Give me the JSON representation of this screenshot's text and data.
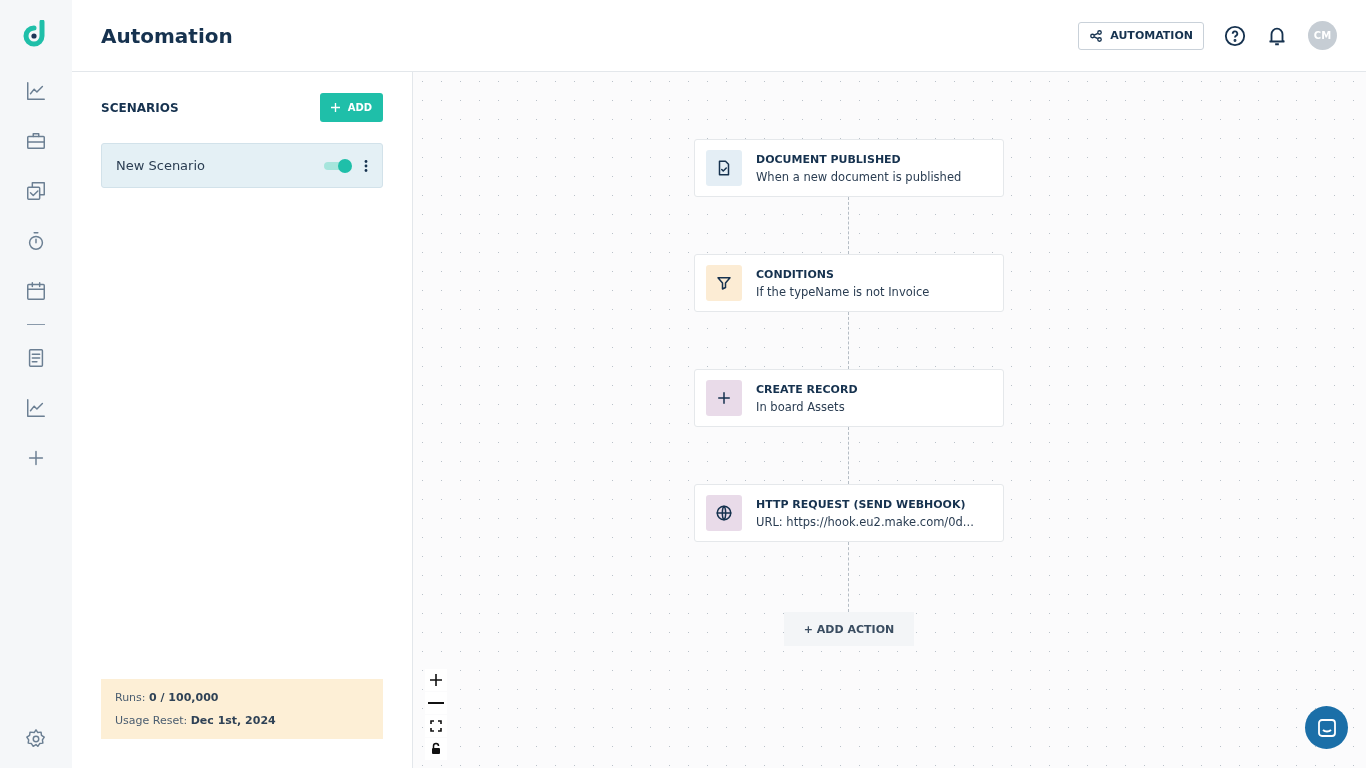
{
  "header": {
    "title": "Automation",
    "automation_button": "AUTOMATION",
    "avatar_initials": "CM"
  },
  "scenarios": {
    "title": "SCENARIOS",
    "add_button": "ADD",
    "items": [
      {
        "name": "New Scenario",
        "on": true,
        "selected": true
      }
    ]
  },
  "usage": {
    "runs": "Runs: **0 / 100,000**",
    "reset": "Usage Reset: **Dec 1st, 2024**"
  },
  "flow": {
    "steps": [
      {
        "kind": "trigger",
        "title": "DOCUMENT PUBLISHED",
        "description": "When a new document is published"
      },
      {
        "kind": "condition",
        "title": "CONDITIONS",
        "description": "If the typeName is not Invoice"
      },
      {
        "kind": "record",
        "title": "CREATE RECORD",
        "description": "In board Assets"
      },
      {
        "kind": "webhook",
        "title": "HTTP REQUEST (SEND WEBHOOK)",
        "description": "URL: https://hook.eu2.make.com/0d..."
      }
    ],
    "add_action": "+ ADD ACTION"
  }
}
